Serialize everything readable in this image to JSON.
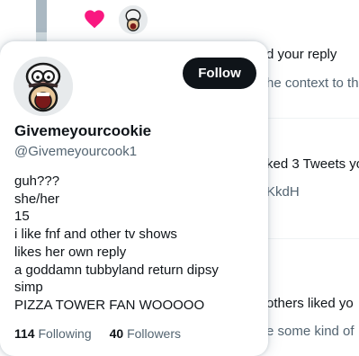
{
  "background_feed": {
    "lines": [
      {
        "text": "d your reply",
        "style": "normal"
      },
      {
        "text": "he context to th",
        "style": "muted"
      },
      {
        "text": "ked 3 Tweets yo",
        "style": "normal"
      },
      {
        "text": "KkdH",
        "style": "muted"
      },
      {
        "text": "others liked yo",
        "style": "normal"
      },
      {
        "text": "e some kind of",
        "style": "muted"
      }
    ]
  },
  "profile_card": {
    "display_name": "Givemeyourcookie",
    "handle": "@Givemeyourcook1",
    "follow_label": "Follow",
    "bio_lines": [
      "guh???",
      "she/her",
      "15",
      "i like fnf and other tv shows",
      "likes her own reply",
      "a goddamn tubbyland return dipsy",
      "simp",
      "PIZZA TOWER FAN WOOOOO"
    ],
    "following_count": "114",
    "following_label": "Following",
    "followers_count": "40",
    "followers_label": "Followers"
  },
  "colors": {
    "like_heart": "#f91880",
    "follow_button_bg": "#0f1419",
    "muted_text": "#536471"
  }
}
